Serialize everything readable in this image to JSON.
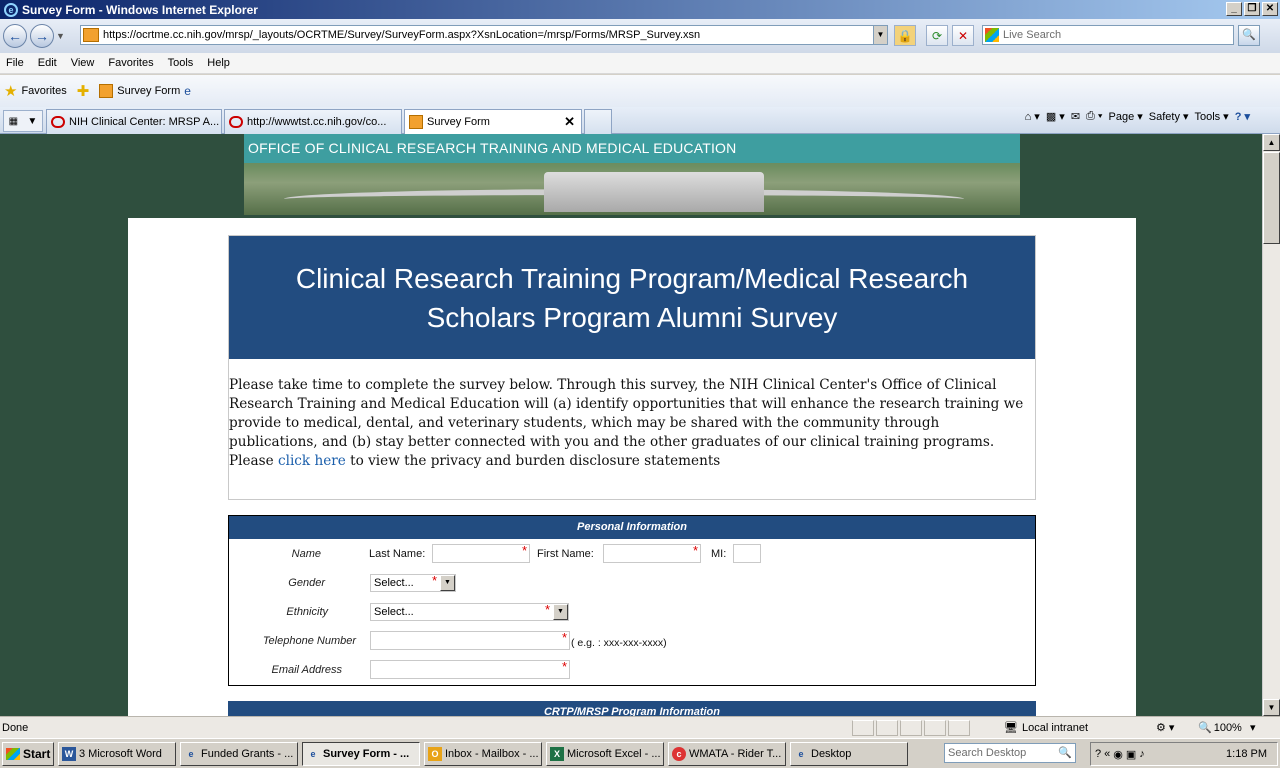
{
  "window": {
    "title": "Survey Form - Windows Internet Explorer",
    "minimize": "_",
    "restore": "❐",
    "close": "✕"
  },
  "addressbar": {
    "url": "https://ocrtme.cc.nih.gov/mrsp/_layouts/OCRTME/Survey/SurveyForm.aspx?XsnLocation=/mrsp/Forms/MRSP_Survey.xsn",
    "search_placeholder": "Live Search"
  },
  "menubar": [
    "File",
    "Edit",
    "View",
    "Favorites",
    "Tools",
    "Help"
  ],
  "favorites": {
    "favorites_label": "Favorites",
    "link_label": "Survey Form"
  },
  "tabs": [
    {
      "label": "NIH Clinical Center: MRSP A..."
    },
    {
      "label": "http://wwwtst.cc.nih.gov/co..."
    },
    {
      "label": "Survey Form"
    }
  ],
  "commandbar": {
    "page": "Page",
    "safety": "Safety",
    "tools": "Tools"
  },
  "banner": {
    "text": "OFFICE OF CLINICAL RESEARCH TRAINING AND MEDICAL EDUCATION"
  },
  "survey": {
    "title": "Clinical Research Training Program/Medical Research Scholars Program Alumni Survey",
    "intro_text": "Please take time to complete the survey below. Through this survey, the NIH Clinical Center's Office of Clinical Research Training and Medical Education will (a) identify opportunities that will enhance the research training we provide to medical, dental, and veterinary students, which may be shared with the community through publications, and (b) stay better connected with you and the other graduates of our clinical training programs. Please ",
    "intro_link": "click here",
    "intro_tail": " to view the privacy and burden disclosure statements",
    "section_personal": "Personal Information",
    "fields": {
      "name_label": "Name",
      "last_name_label": "Last Name:",
      "first_name_label": "First Name:",
      "mi_label": "MI:",
      "gender_label": "Gender",
      "gender_value": "Select...",
      "ethnicity_label": "Ethnicity",
      "ethnicity_value": "Select...",
      "telephone_label": "Telephone Number",
      "telephone_hint": "( e.g. : xxx-xxx-xxxx)",
      "email_label": "Email Address",
      "required_mark": "*"
    },
    "section_next": "CRTP/MRSP Program Information"
  },
  "statusbar": {
    "status": "Done",
    "zone": "Local intranet",
    "zoom": "100%"
  },
  "taskbar": {
    "start": "Start",
    "tasks": [
      {
        "label": "3 Microsoft Word",
        "icon": "W"
      },
      {
        "label": "Funded Grants - ...",
        "icon": "e"
      },
      {
        "label": "Survey Form - ...",
        "icon": "e"
      },
      {
        "label": "Inbox - Mailbox - ...",
        "icon": "O"
      },
      {
        "label": "Microsoft Excel - ...",
        "icon": "X"
      },
      {
        "label": "WMATA - Rider T...",
        "icon": "c"
      },
      {
        "label": "Desktop",
        "icon": "e"
      }
    ],
    "search_desktop": "Search Desktop",
    "clock": "1:18 PM"
  }
}
